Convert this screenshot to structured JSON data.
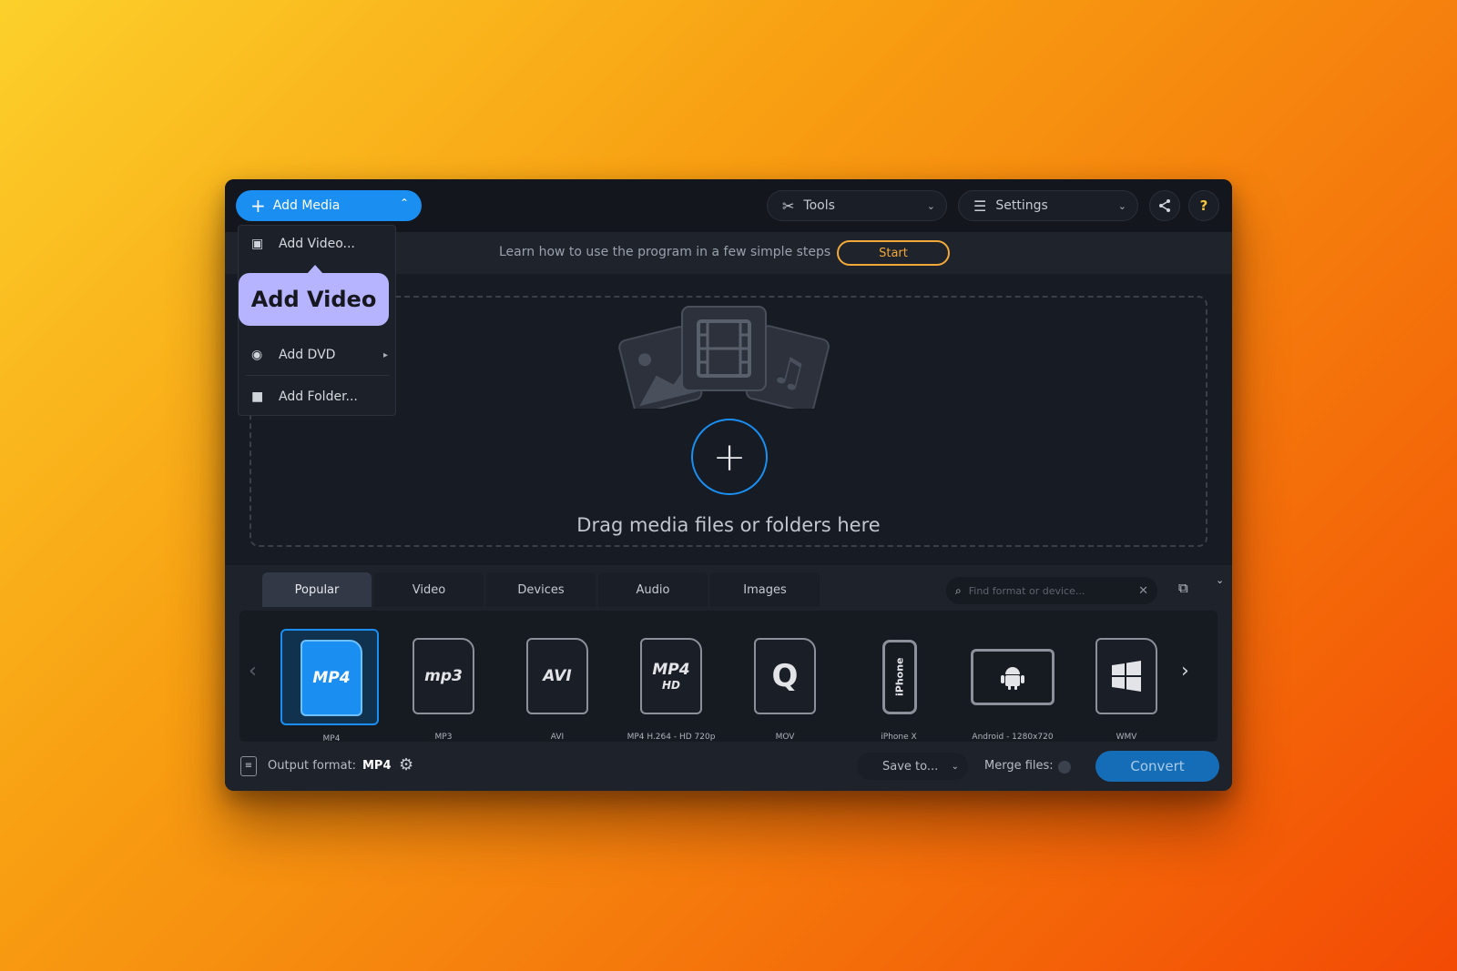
{
  "topbar": {
    "add_media_label": "Add Media",
    "tools_label": "Tools",
    "settings_label": "Settings",
    "help_label": "?"
  },
  "learnbar": {
    "text": "Learn how to use the program in a few simple steps",
    "start_label": "Start"
  },
  "dropdown": {
    "items": [
      {
        "label": "Add Video...",
        "icon": "film-frame-icon"
      },
      {
        "label": "Add DVD",
        "icon": "disc-icon"
      },
      {
        "label": "Add Folder...",
        "icon": "folder-icon"
      }
    ],
    "tooltip": "Add Video"
  },
  "dropzone": {
    "text": "Drag media files or folders here"
  },
  "tabs": [
    "Popular",
    "Video",
    "Devices",
    "Audio",
    "Images"
  ],
  "active_tab": "Popular",
  "search": {
    "placeholder": "Find format or device..."
  },
  "formats": [
    {
      "label": "MP4",
      "badge": "MP4",
      "sub": "",
      "selected": true
    },
    {
      "label": "MP3",
      "badge": "mp3",
      "sub": "",
      "selected": false
    },
    {
      "label": "AVI",
      "badge": "AVI",
      "sub": "",
      "selected": false
    },
    {
      "label": "MP4 H.264 - HD 720p",
      "badge": "MP4",
      "sub": "HD",
      "selected": false
    },
    {
      "label": "MOV",
      "badge": "Q",
      "sub": "",
      "selected": false
    },
    {
      "label": "iPhone X",
      "badge": "iPhone",
      "sub": "",
      "selected": false
    },
    {
      "label": "Android - 1280x720",
      "badge": "android",
      "sub": "",
      "selected": false
    },
    {
      "label": "WMV",
      "badge": "win",
      "sub": "",
      "selected": false
    }
  ],
  "statusbar": {
    "output_label": "Output format:",
    "output_value": "MP4",
    "save_to_label": "Save to...",
    "merge_label": "Merge files:",
    "convert_label": "Convert"
  },
  "colors": {
    "accent": "#1a8ff1",
    "start_outline": "#f3a93a",
    "tooltip_bg": "#b6b4ff",
    "window_bg": "#171b23"
  }
}
